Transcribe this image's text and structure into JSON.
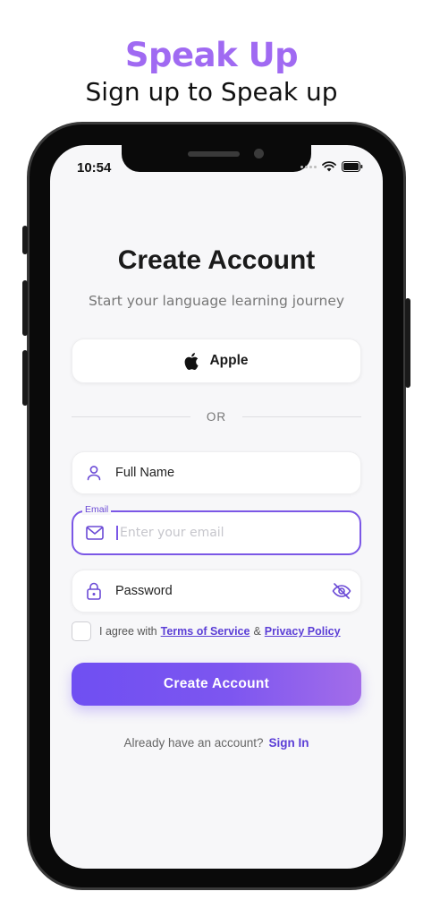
{
  "promo": {
    "title": "Speak Up",
    "subtitle": "Sign up to Speak up"
  },
  "status_bar": {
    "time": "10:54",
    "icons": [
      "signal-icon",
      "wifi-icon",
      "battery-icon"
    ]
  },
  "screen": {
    "heading": "Create Account",
    "subheading": "Start your language learning journey",
    "apple_button": {
      "label": "Apple",
      "icon": "apple-logo-icon"
    },
    "divider_text": "OR",
    "full_name": {
      "label": "Full Name",
      "icon": "user-icon"
    },
    "email": {
      "floating_label": "Email",
      "placeholder": "Enter your email",
      "value": "",
      "icon": "mail-icon"
    },
    "password": {
      "label": "Password",
      "icon": "lock-icon",
      "toggle_icon": "eye-off-icon"
    },
    "terms": {
      "prefix": "I agree with",
      "terms_link": "Terms of Service",
      "amp": "&",
      "privacy_link": "Privacy Policy",
      "checked": false
    },
    "primary_button": "Create Account",
    "signin_prompt": "Already have an account?",
    "signin_link": "Sign In"
  },
  "colors": {
    "accent": "#7b57e6",
    "promo_title": "#a06af2",
    "link": "#5b3ed6",
    "screen_bg": "#f7f7f9"
  }
}
